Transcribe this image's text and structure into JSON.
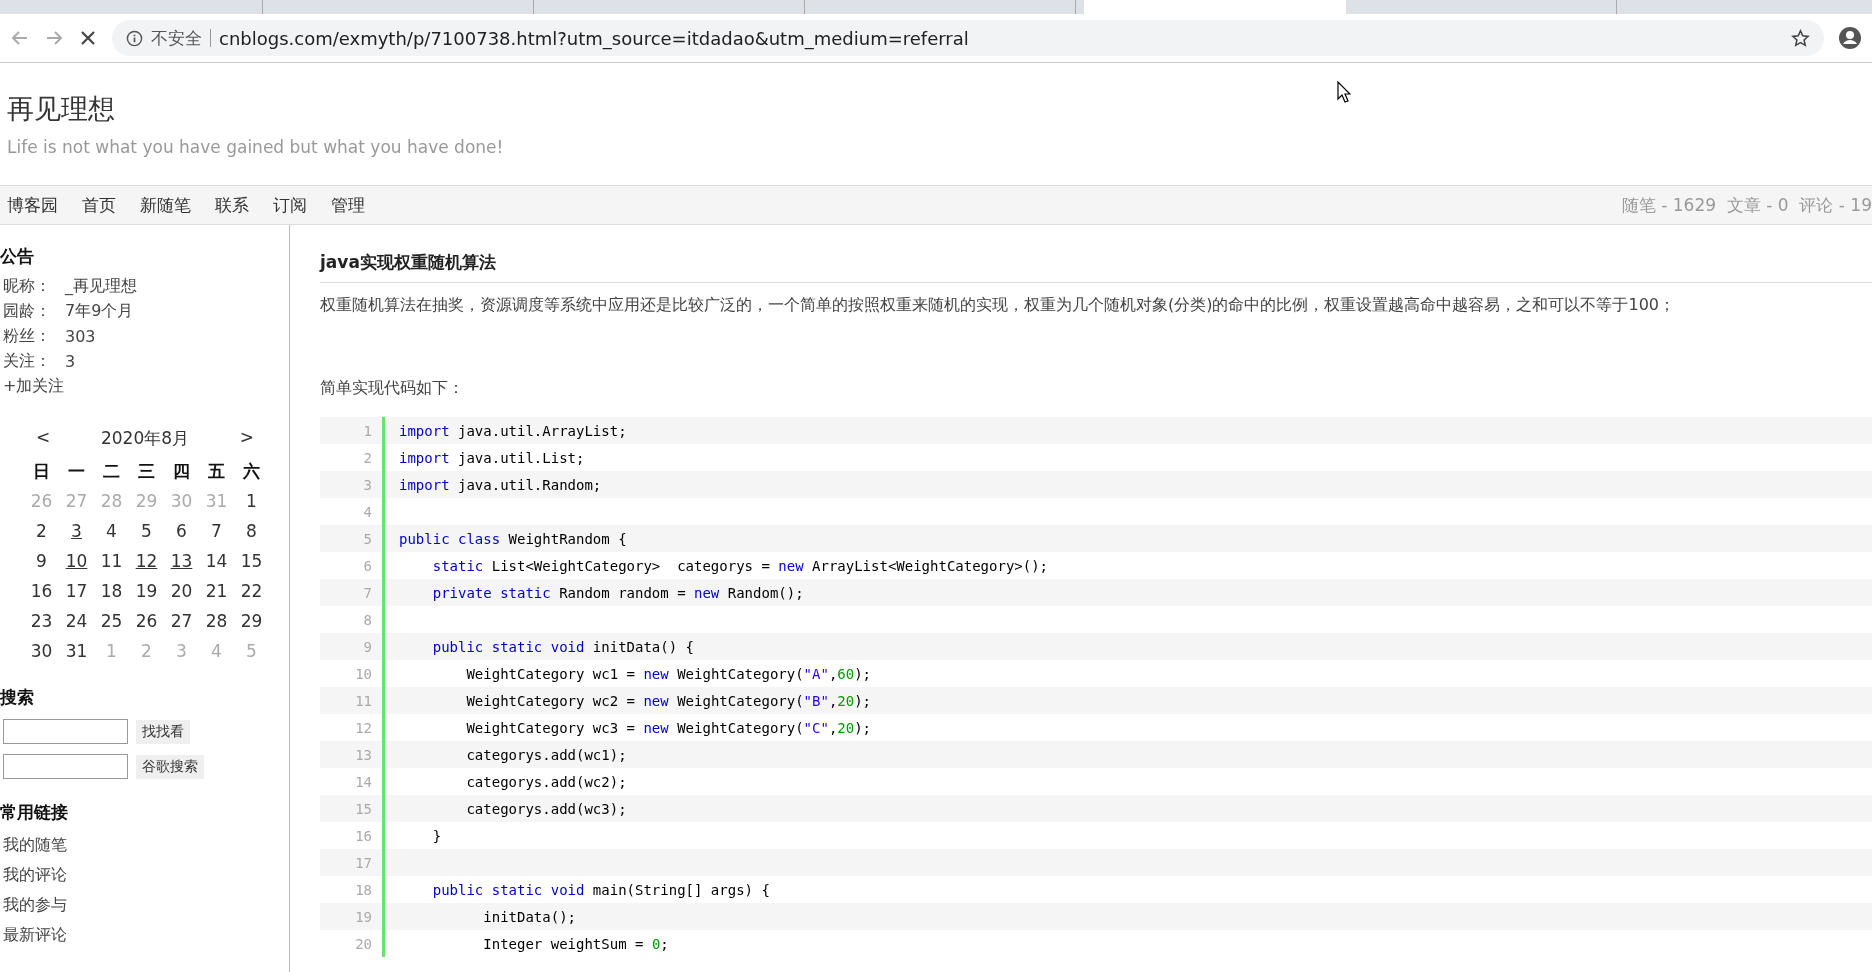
{
  "browser": {
    "tabs": [
      {
        "selected": false
      },
      {
        "selected": false
      },
      {
        "selected": false
      },
      {
        "selected": false
      },
      {
        "selected": true
      },
      {
        "selected": false
      }
    ],
    "security": "不安全",
    "url": "cnblogs.com/exmyth/p/7100738.html?utm_source=itdadao&utm_medium=referral"
  },
  "blog": {
    "title": "再见理想",
    "subtitle": "Life is not what you have gained but what you have done!"
  },
  "nav": {
    "items": [
      "博客园",
      "首页",
      "新随笔",
      "联系",
      "订阅",
      "管理"
    ],
    "stats": "随笔 - 1629  文章 - 0  评论 - 19"
  },
  "sidebar": {
    "notice_title": "公告",
    "profile": [
      {
        "label": "昵称：",
        "value": "_再见理想"
      },
      {
        "label": "园龄：",
        "value": "7年9个月"
      },
      {
        "label": "粉丝：",
        "value": "303"
      },
      {
        "label": "关注：",
        "value": "3"
      }
    ],
    "follow": "+加关注",
    "calendar": {
      "prev": "<",
      "month": "2020年8月",
      "next": ">",
      "weekdays": [
        "日",
        "一",
        "二",
        "三",
        "四",
        "五",
        "六"
      ],
      "days": [
        {
          "d": "26",
          "other_month": true,
          "has_posts": false
        },
        {
          "d": "27",
          "other_month": true,
          "has_posts": false
        },
        {
          "d": "28",
          "other_month": true,
          "has_posts": false
        },
        {
          "d": "29",
          "other_month": true,
          "has_posts": false
        },
        {
          "d": "30",
          "other_month": true,
          "has_posts": false
        },
        {
          "d": "31",
          "other_month": true,
          "has_posts": false
        },
        {
          "d": "1",
          "other_month": false,
          "has_posts": false
        },
        {
          "d": "2",
          "other_month": false,
          "has_posts": false
        },
        {
          "d": "3",
          "other_month": false,
          "has_posts": true
        },
        {
          "d": "4",
          "other_month": false,
          "has_posts": false
        },
        {
          "d": "5",
          "other_month": false,
          "has_posts": false
        },
        {
          "d": "6",
          "other_month": false,
          "has_posts": false
        },
        {
          "d": "7",
          "other_month": false,
          "has_posts": false
        },
        {
          "d": "8",
          "other_month": false,
          "has_posts": false
        },
        {
          "d": "9",
          "other_month": false,
          "has_posts": false
        },
        {
          "d": "10",
          "other_month": false,
          "has_posts": true
        },
        {
          "d": "11",
          "other_month": false,
          "has_posts": false
        },
        {
          "d": "12",
          "other_month": false,
          "has_posts": true
        },
        {
          "d": "13",
          "other_month": false,
          "has_posts": true
        },
        {
          "d": "14",
          "other_month": false,
          "has_posts": false
        },
        {
          "d": "15",
          "other_month": false,
          "has_posts": false
        },
        {
          "d": "16",
          "other_month": false,
          "has_posts": false
        },
        {
          "d": "17",
          "other_month": false,
          "has_posts": false
        },
        {
          "d": "18",
          "other_month": false,
          "has_posts": false
        },
        {
          "d": "19",
          "other_month": false,
          "has_posts": false
        },
        {
          "d": "20",
          "other_month": false,
          "has_posts": false
        },
        {
          "d": "21",
          "other_month": false,
          "has_posts": false
        },
        {
          "d": "22",
          "other_month": false,
          "has_posts": false
        },
        {
          "d": "23",
          "other_month": false,
          "has_posts": false
        },
        {
          "d": "24",
          "other_month": false,
          "has_posts": false
        },
        {
          "d": "25",
          "other_month": false,
          "has_posts": false
        },
        {
          "d": "26",
          "other_month": false,
          "has_posts": false
        },
        {
          "d": "27",
          "other_month": false,
          "has_posts": false
        },
        {
          "d": "28",
          "other_month": false,
          "has_posts": false
        },
        {
          "d": "29",
          "other_month": false,
          "has_posts": false
        },
        {
          "d": "30",
          "other_month": false,
          "has_posts": false
        },
        {
          "d": "31",
          "other_month": false,
          "has_posts": false
        },
        {
          "d": "1",
          "other_month": true,
          "has_posts": false
        },
        {
          "d": "2",
          "other_month": true,
          "has_posts": false
        },
        {
          "d": "3",
          "other_month": true,
          "has_posts": false
        },
        {
          "d": "4",
          "other_month": true,
          "has_posts": false
        },
        {
          "d": "5",
          "other_month": true,
          "has_posts": false
        }
      ]
    },
    "search_title": "搜索",
    "search_button": "找找看",
    "google_button": "谷歌搜索",
    "links_title": "常用链接",
    "links": [
      "我的随笔",
      "我的评论",
      "我的参与",
      "最新评论"
    ]
  },
  "post": {
    "title": "java实现权重随机算法",
    "intro": "权重随机算法在抽奖，资源调度等系统中应用还是比较广泛的，一个简单的按照权重来随机的实现，权重为几个随机对象(分类)的命中的比例，权重设置越高命中越容易，之和可以不等于100；",
    "code_label": "简单实现代码如下：",
    "code": [
      {
        "n": "1",
        "tokens": [
          {
            "t": "import",
            "kind": "keyword"
          },
          {
            "t": " java.util.ArrayList;",
            "kind": "plain"
          }
        ]
      },
      {
        "n": "2",
        "tokens": [
          {
            "t": "import",
            "kind": "keyword"
          },
          {
            "t": " java.util.List;",
            "kind": "plain"
          }
        ]
      },
      {
        "n": "3",
        "tokens": [
          {
            "t": "import",
            "kind": "keyword"
          },
          {
            "t": " java.util.Random;",
            "kind": "plain"
          }
        ]
      },
      {
        "n": "4"
      },
      {
        "n": "5",
        "tokens": [
          {
            "t": "public class",
            "kind": "keyword"
          },
          {
            "t": " WeightRandom {",
            "kind": "plain"
          }
        ]
      },
      {
        "n": "6",
        "tokens": [
          {
            "t": "    static",
            "kind": "keyword"
          },
          {
            "t": " List<WeightCategory>  categorys = ",
            "kind": "plain"
          },
          {
            "t": "new",
            "kind": "keyword"
          },
          {
            "t": " ArrayList<WeightCategory>();",
            "kind": "plain"
          }
        ]
      },
      {
        "n": "7",
        "tokens": [
          {
            "t": "    private static",
            "kind": "keyword"
          },
          {
            "t": " Random random = ",
            "kind": "plain"
          },
          {
            "t": "new",
            "kind": "keyword"
          },
          {
            "t": " Random();",
            "kind": "plain"
          }
        ]
      },
      {
        "n": "8"
      },
      {
        "n": "9",
        "tokens": [
          {
            "t": "    public static void",
            "kind": "keyword"
          },
          {
            "t": " initData() {",
            "kind": "plain"
          }
        ]
      },
      {
        "n": "10",
        "tokens": [
          {
            "t": "        WeightCategory wc1 = ",
            "kind": "plain"
          },
          {
            "t": "new",
            "kind": "keyword"
          },
          {
            "t": " WeightCategory(",
            "kind": "plain"
          },
          {
            "t": "\"A\"",
            "kind": "string"
          },
          {
            "t": ",",
            "kind": "plain"
          },
          {
            "t": "60",
            "kind": "number"
          },
          {
            "t": ");",
            "kind": "plain"
          }
        ]
      },
      {
        "n": "11",
        "tokens": [
          {
            "t": "        WeightCategory wc2 = ",
            "kind": "plain"
          },
          {
            "t": "new",
            "kind": "keyword"
          },
          {
            "t": " WeightCategory(",
            "kind": "plain"
          },
          {
            "t": "\"B\"",
            "kind": "string"
          },
          {
            "t": ",",
            "kind": "plain"
          },
          {
            "t": "20",
            "kind": "number"
          },
          {
            "t": ");",
            "kind": "plain"
          }
        ]
      },
      {
        "n": "12",
        "tokens": [
          {
            "t": "        WeightCategory wc3 = ",
            "kind": "plain"
          },
          {
            "t": "new",
            "kind": "keyword"
          },
          {
            "t": " WeightCategory(",
            "kind": "plain"
          },
          {
            "t": "\"C\"",
            "kind": "string"
          },
          {
            "t": ",",
            "kind": "plain"
          },
          {
            "t": "20",
            "kind": "number"
          },
          {
            "t": ");",
            "kind": "plain"
          }
        ]
      },
      {
        "n": "13",
        "tokens": [
          {
            "t": "        categorys.add(wc1);",
            "kind": "plain"
          }
        ]
      },
      {
        "n": "14",
        "tokens": [
          {
            "t": "        categorys.add(wc2);",
            "kind": "plain"
          }
        ]
      },
      {
        "n": "15",
        "tokens": [
          {
            "t": "        categorys.add(wc3);",
            "kind": "plain"
          }
        ]
      },
      {
        "n": "16",
        "tokens": [
          {
            "t": "    }",
            "kind": "plain"
          }
        ]
      },
      {
        "n": "17"
      },
      {
        "n": "18",
        "tokens": [
          {
            "t": "    public static void",
            "kind": "keyword"
          },
          {
            "t": " main(String[] args) {",
            "kind": "plain"
          }
        ]
      },
      {
        "n": "19",
        "tokens": [
          {
            "t": "          initData();",
            "kind": "plain"
          }
        ]
      },
      {
        "n": "20",
        "tokens": [
          {
            "t": "          Integer weightSum = ",
            "kind": "plain"
          },
          {
            "t": "0",
            "kind": "number"
          },
          {
            "t": ";",
            "kind": "plain"
          }
        ]
      }
    ]
  }
}
